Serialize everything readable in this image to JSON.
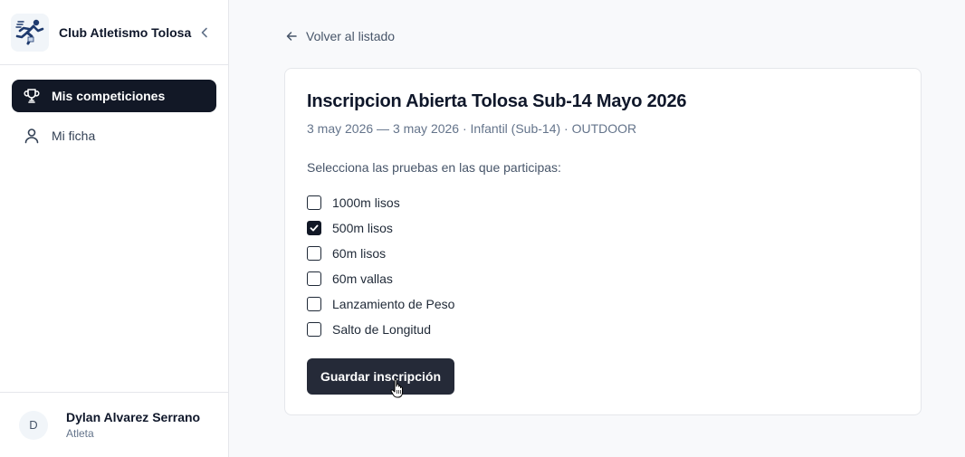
{
  "sidebar": {
    "club_name": "Club Atletismo Tolosa",
    "nav": [
      {
        "label": "Mis competiciones",
        "icon": "trophy-icon",
        "active": true
      },
      {
        "label": "Mi ficha",
        "icon": "user-icon",
        "active": false
      }
    ],
    "user": {
      "initial": "D",
      "name": "Dylan Alvarez Serrano",
      "role": "Atleta"
    }
  },
  "main": {
    "back_label": "Volver al listado",
    "title": "Inscripcion Abierta Tolosa Sub-14 Mayo 2026",
    "meta": "3 may 2026 — 3 may 2026 · Infantil (Sub-14) · OUTDOOR",
    "prompt": "Selecciona las pruebas en las que participas:",
    "events": [
      {
        "label": "1000m lisos",
        "checked": false
      },
      {
        "label": "500m lisos",
        "checked": true
      },
      {
        "label": "60m lisos",
        "checked": false
      },
      {
        "label": "60m vallas",
        "checked": false
      },
      {
        "label": "Lanzamiento de Peso",
        "checked": false
      },
      {
        "label": "Salto de Longitud",
        "checked": false
      }
    ],
    "save_label": "Guardar inscripción"
  },
  "colors": {
    "primary": "#121826",
    "button": "#252a38",
    "muted": "#64748b"
  }
}
